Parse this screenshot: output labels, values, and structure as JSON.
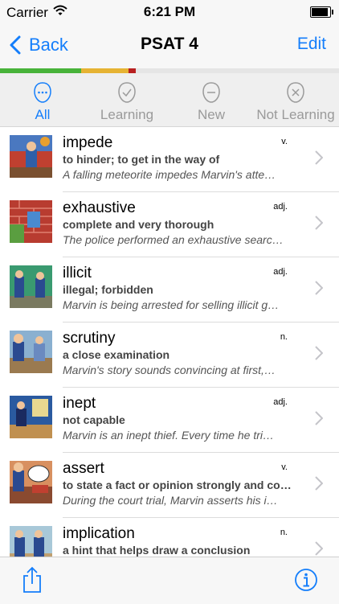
{
  "status_bar": {
    "carrier": "Carrier",
    "time": "6:21 PM",
    "wifi_icon": "wifi-icon",
    "battery_icon": "battery-icon"
  },
  "nav": {
    "back_label": "Back",
    "title": "PSAT 4",
    "edit_label": "Edit"
  },
  "colors": {
    "accent": "#147efb",
    "progress_green": "#48b33a",
    "progress_yellow": "#e6b333",
    "progress_red": "#b82020"
  },
  "progress": {
    "mastered_fraction": 0.24,
    "learning_fraction": 0.14,
    "not_learning_fraction": 0.02
  },
  "filters": [
    {
      "label": "All",
      "icon": "ellipsis-face-icon",
      "active": true
    },
    {
      "label": "Learning",
      "icon": "check-face-icon",
      "active": false
    },
    {
      "label": "New",
      "icon": "minus-face-icon",
      "active": false
    },
    {
      "label": "Not Learning",
      "icon": "x-face-icon",
      "active": false
    }
  ],
  "words": [
    {
      "word": "impede",
      "pos": "v.",
      "definition": "to hinder; to get in the way of",
      "example": "A falling meteorite impedes Marvin's atte…"
    },
    {
      "word": "exhaustive",
      "pos": "adj.",
      "definition": "complete and very thorough",
      "example": "The police performed an exhaustive searc…"
    },
    {
      "word": "illicit",
      "pos": "adj.",
      "definition": "illegal; forbidden",
      "example": "Marvin is being arrested for selling illicit g…"
    },
    {
      "word": "scrutiny",
      "pos": "n.",
      "definition": "a close examination",
      "example": "Marvin's story sounds convincing at first,…"
    },
    {
      "word": "inept",
      "pos": "adj.",
      "definition": "not capable",
      "example": "Marvin is an inept thief.  Every time he tri…"
    },
    {
      "word": "assert",
      "pos": "v.",
      "definition": "to state a fact or opinion strongly and co…",
      "example": "During the court trial, Marvin asserts his i…"
    },
    {
      "word": "implication",
      "pos": "n.",
      "definition": "a hint that helps draw a conclusion",
      "example": ""
    }
  ],
  "toolbar": {
    "share_icon": "share-icon",
    "info_icon": "info-icon"
  }
}
